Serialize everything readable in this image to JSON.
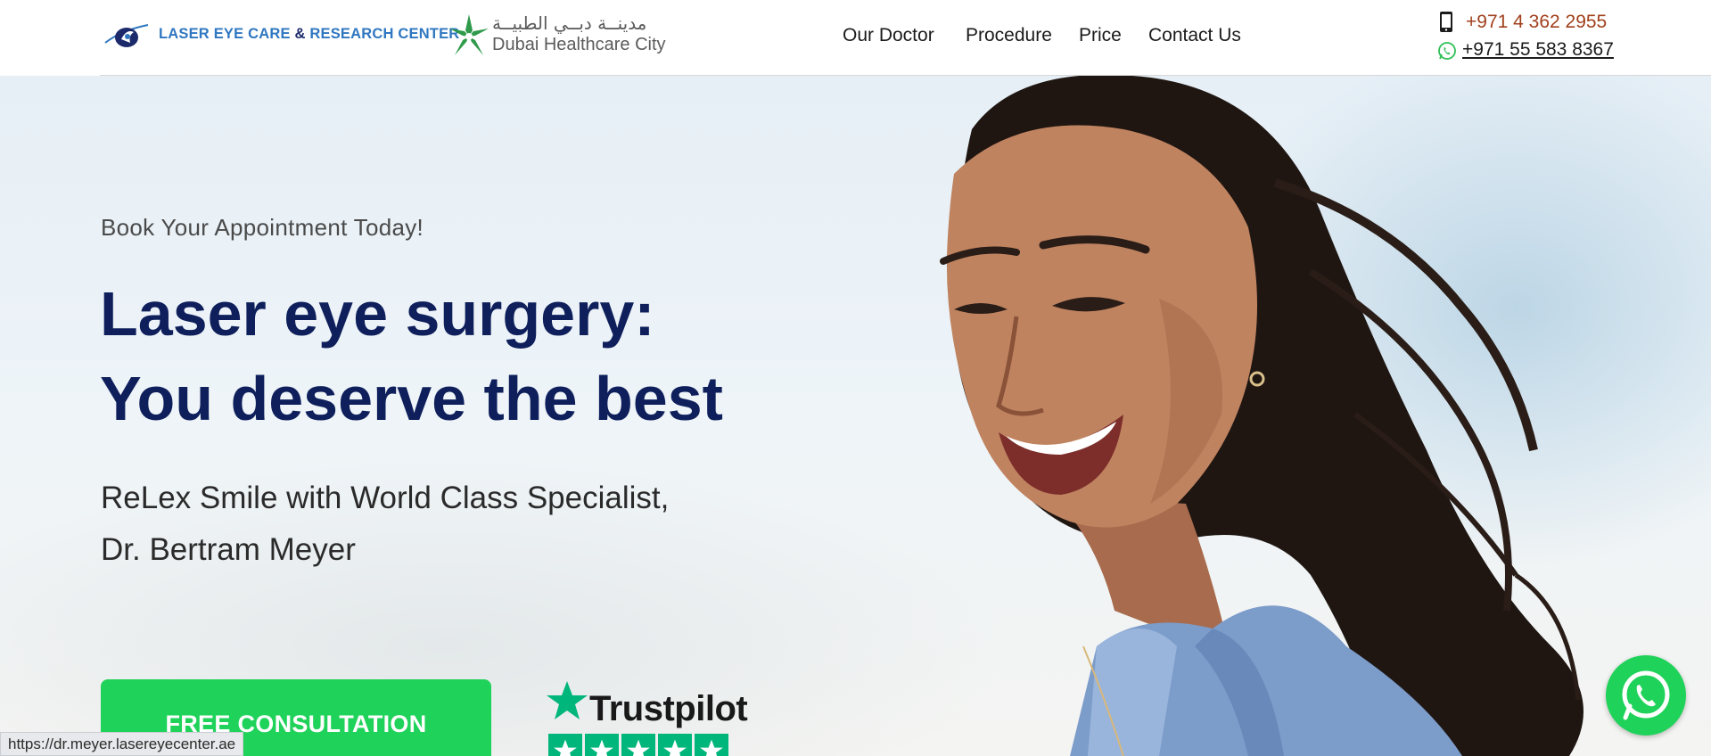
{
  "header": {
    "logo_text_1": "LASER EYE CARE",
    "logo_text_amp": "&",
    "logo_text_2": "RESEARCH CENTER",
    "partner_arabic": "مدينــة دبــي الطبيــة",
    "partner_english": "Dubai Healthcare City",
    "nav": [
      "Our Doctor",
      "Procedure",
      "Price",
      "Contact Us"
    ],
    "phone": "+971 4 362 2955",
    "whatsapp": "+971 55 583 8367"
  },
  "hero": {
    "eyebrow": "Book Your Appointment Today!",
    "headline_line1": "Laser eye surgery:",
    "headline_line2": "You deserve the best",
    "sub_line1": "ReLex Smile with World Class Specialist,",
    "sub_line2": "Dr. Bertram Meyer",
    "cta_label": "FREE CONSULTATION",
    "trustpilot": "Trustpilot",
    "trustpilot_rating_stars": 5
  },
  "status_bar": {
    "url": "https://dr.meyer.lasereyecenter.ae"
  },
  "colors": {
    "brand_navy": "#0e1f5b",
    "brand_blue": "#2f77c0",
    "cta_green": "#1fd259",
    "trustpilot_green": "#00b67a",
    "phone_color": "#a0401c"
  },
  "icons": [
    "laser-eye-logo-icon",
    "dhc-star-logo-icon",
    "mobile-phone-icon",
    "whatsapp-icon",
    "trustpilot-star-icon",
    "whatsapp-float-icon"
  ]
}
